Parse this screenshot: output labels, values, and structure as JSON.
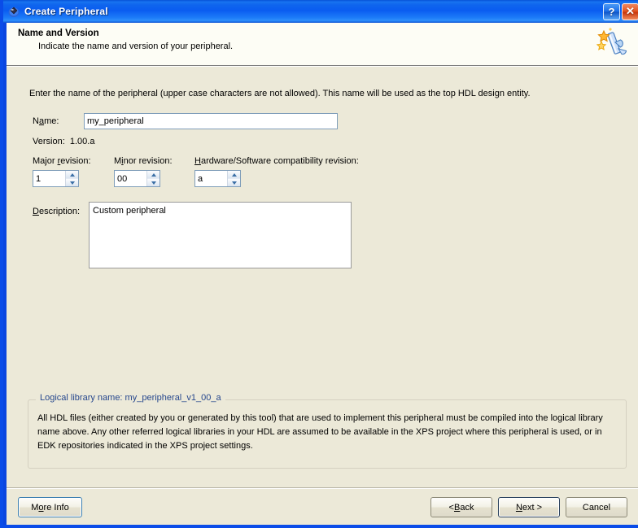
{
  "window": {
    "title": "Create Peripheral",
    "title_icon": "peripheral-gem-icon",
    "help_button": "?",
    "close_button": "✕"
  },
  "header": {
    "title": "Name and Version",
    "subtitle": "Indicate the name and version of your peripheral.",
    "icon": "wizard-wand-puzzle-icon"
  },
  "main": {
    "instruction": "Enter the name of the peripheral (upper case characters are not allowed). This name will be used as the top HDL design entity.",
    "name": {
      "label_before": "N",
      "label_accel": "a",
      "label_after": "me:",
      "value": "my_peripheral"
    },
    "version": {
      "label": "Version:",
      "value": "1.00.a"
    },
    "major_revision": {
      "label_before": "Major ",
      "label_accel": "r",
      "label_after": "evision:",
      "value": "1"
    },
    "minor_revision": {
      "label_before": "M",
      "label_accel": "i",
      "label_after": "nor revision:",
      "value": "00"
    },
    "compat_revision": {
      "label_before": "",
      "label_accel": "H",
      "label_after": "ardware/Software compatibility revision:",
      "value": "a"
    },
    "description": {
      "label_before": "",
      "label_accel": "D",
      "label_after": "escription:",
      "value": "Custom peripheral"
    }
  },
  "group": {
    "legend": "Logical library name: my_peripheral_v1_00_a",
    "body": "All HDL files (either created by you or generated by this tool) that are used to implement this peripheral must be compiled into the logical library name above. Any other referred logical libraries in your HDL are assumed to be available in the XPS project where this peripheral is used, or in EDK repositories indicated in the XPS project settings."
  },
  "footer": {
    "more_info_before": "M",
    "more_info_accel": "o",
    "more_info_after": "re Info",
    "back_before": "< ",
    "back_accel": "B",
    "back_after": "ack",
    "next_before": "",
    "next_accel": "N",
    "next_after": "ext >",
    "cancel": "Cancel"
  },
  "colors": {
    "title_blue": "#0a5cf0",
    "content_beige": "#ece9d8",
    "legend_blue": "#26478d",
    "input_border": "#7f9db9"
  }
}
